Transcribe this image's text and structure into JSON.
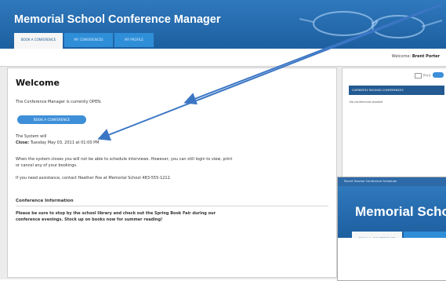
{
  "header": {
    "app_title": "Memorial School Conference Manager",
    "tabs": [
      {
        "label": "BOOK A CONFERENCE",
        "active": true
      },
      {
        "label": "MY CONFERENCES",
        "active": false
      },
      {
        "label": "MY PROFILE",
        "active": false
      }
    ]
  },
  "subbar": {
    "welcome_prefix": "Welcome:",
    "user_name": "Brent Porter"
  },
  "main": {
    "title": "Welcome",
    "status_line": "The Conference Manager is currently OPEN.",
    "book_button": "BOOK A CONFERENCE",
    "close_line_1": "The System will",
    "close_label": "Close:",
    "close_time": "Tuesday May 03, 2011 at 01:00 PM",
    "after_close_1": "When the system closes you will not be able to schedule interviews. However, you can still login to view, print",
    "after_close_2": "or cancel any of your bookings.",
    "assistance": "If you need assistance, contact Heather Poe at Memorial School 483-555-1212.",
    "section_title": "Conference Information",
    "info_1": "Please be sure to stop by the school library and check out the Spring Book Fair during our",
    "info_2": "conference evenings. Stock up on books now for summer reading!"
  },
  "right_panel": {
    "print_label": "Print",
    "header": "CURRENTLY BOOKED CONFERENCES",
    "empty_text": "No conferences booked"
  },
  "inset": {
    "titlebar_text": "Parent Teacher Conference Scheduler",
    "title": "Memorial School",
    "tab_label": "BOOK A CONFERENCE"
  },
  "colors": {
    "header_blue": "#2f79bd",
    "button_blue": "#3d8fd8",
    "panel_header": "#235a91",
    "arrow": "#3b76c4"
  }
}
